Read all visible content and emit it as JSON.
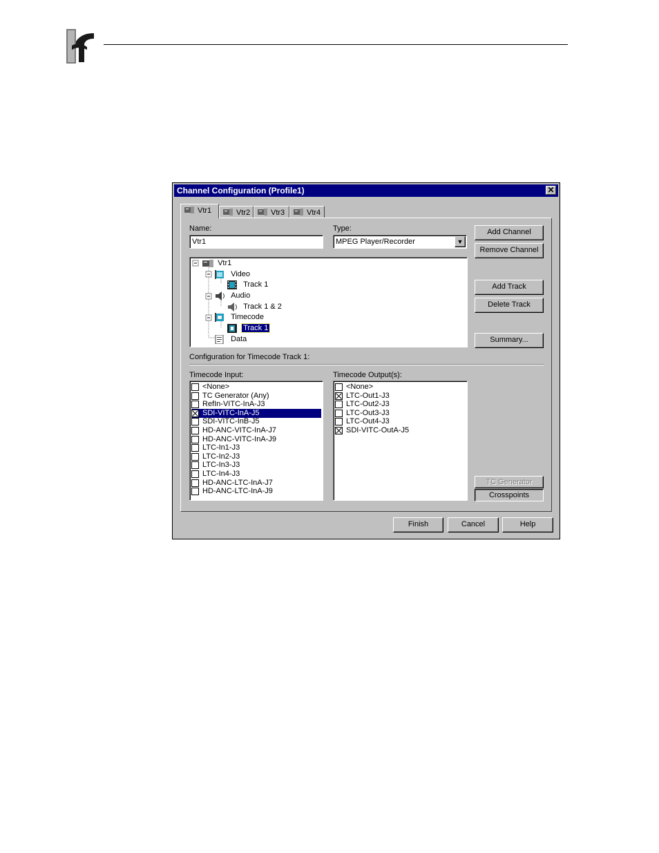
{
  "dialog": {
    "title": "Channel Configuration (Profile1)",
    "tabs": [
      {
        "label": "Vtr1",
        "active": true
      },
      {
        "label": "Vtr2",
        "active": false
      },
      {
        "label": "Vtr3",
        "active": false
      },
      {
        "label": "Vtr4",
        "active": false
      }
    ],
    "name_label": "Name:",
    "name_value": "Vtr1",
    "type_label": "Type:",
    "type_value": "MPEG Player/Recorder",
    "tree": [
      {
        "label": "Vtr1",
        "level": 0,
        "icon": "vtr-icon"
      },
      {
        "label": "Video",
        "level": 1,
        "icon": "video-icon"
      },
      {
        "label": "Track 1",
        "level": 2,
        "icon": "film-track-icon"
      },
      {
        "label": "Audio",
        "level": 1,
        "icon": "speaker-icon"
      },
      {
        "label": "Track 1 & 2",
        "level": 2,
        "icon": "speaker-track-icon"
      },
      {
        "label": "Timecode",
        "level": 1,
        "icon": "timecode-icon"
      },
      {
        "label": "Track 1",
        "level": 2,
        "icon": "timecode-track-icon",
        "selected": true
      },
      {
        "label": "Data",
        "level": 1,
        "icon": "data-icon"
      }
    ],
    "config_label": "Configuration for Timecode Track 1:",
    "tc_input_label": "Timecode Input:",
    "tc_inputs": [
      {
        "label": "<None>",
        "checked": false
      },
      {
        "label": "TC Generator (Any)",
        "checked": false
      },
      {
        "label": "RefIn-VITC-InA-J3",
        "checked": false
      },
      {
        "label": "SDI-VITC-InA-J5",
        "checked": true,
        "selected": true
      },
      {
        "label": "SDI-VITC-InB-J5",
        "checked": false
      },
      {
        "label": "HD-ANC-VITC-InA-J7",
        "checked": false
      },
      {
        "label": "HD-ANC-VITC-InA-J9",
        "checked": false
      },
      {
        "label": "LTC-In1-J3",
        "checked": false
      },
      {
        "label": "LTC-In2-J3",
        "checked": false
      },
      {
        "label": "LTC-In3-J3",
        "checked": false
      },
      {
        "label": "LTC-In4-J3",
        "checked": false
      },
      {
        "label": "HD-ANC-LTC-InA-J7",
        "checked": false
      },
      {
        "label": "HD-ANC-LTC-InA-J9",
        "checked": false
      }
    ],
    "tc_output_label": "Timecode Output(s):",
    "tc_outputs": [
      {
        "label": "<None>",
        "checked": false
      },
      {
        "label": "LTC-Out1-J3",
        "checked": true
      },
      {
        "label": "LTC-Out2-J3",
        "checked": false
      },
      {
        "label": "LTC-Out3-J3",
        "checked": false
      },
      {
        "label": "LTC-Out4-J3",
        "checked": false
      },
      {
        "label": "SDI-VITC-OutA-J5",
        "checked": true
      }
    ],
    "buttons": {
      "add_channel": "Add Channel",
      "remove_channel": "Remove Channel",
      "add_track": "Add Track",
      "delete_track": "Delete Track",
      "summary": "Summary...",
      "tc_generator": "TC Generator",
      "crosspoints": "Crosspoints",
      "finish": "Finish",
      "cancel": "Cancel",
      "help": "Help"
    },
    "colors": {
      "titlebar": "#000080",
      "face": "#c0c0c0",
      "selection": "#000080"
    }
  }
}
